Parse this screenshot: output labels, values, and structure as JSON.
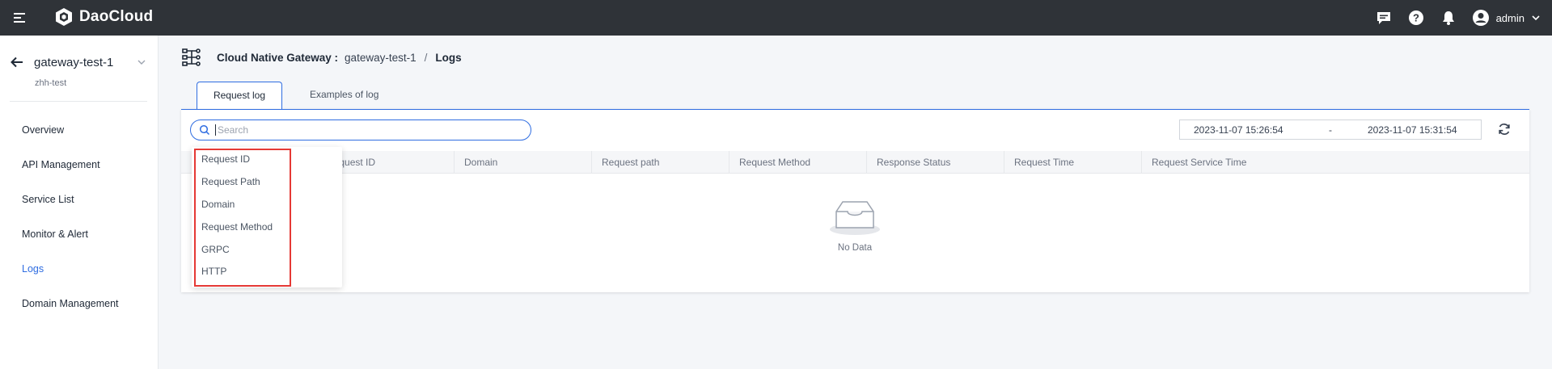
{
  "app": {
    "brand": "DaoCloud"
  },
  "user": {
    "name": "admin"
  },
  "sidebar": {
    "gateway_name": "gateway-test-1",
    "gateway_sub": "zhh-test",
    "items": [
      {
        "label": "Overview"
      },
      {
        "label": "API Management"
      },
      {
        "label": "Service List"
      },
      {
        "label": "Monitor & Alert"
      },
      {
        "label": "Logs"
      },
      {
        "label": "Domain Management"
      }
    ]
  },
  "breadcrumb": {
    "title": "Cloud Native Gateway :",
    "gateway": "gateway-test-1",
    "separator": "/",
    "current": "Logs"
  },
  "tabs": [
    {
      "label": "Request log"
    },
    {
      "label": "Examples of log"
    }
  ],
  "search": {
    "placeholder": "Search",
    "value": ""
  },
  "date_range": {
    "start": "2023-11-07 15:26:54",
    "separator": "-",
    "end": "2023-11-07 15:31:54"
  },
  "table": {
    "columns": [
      "Request ID",
      "Domain",
      "Request path",
      "Request Method",
      "Response Status",
      "Request Time",
      "Request Service Time"
    ],
    "empty_text": "No Data"
  },
  "search_fields_dropdown": [
    "Request ID",
    "Request Path",
    "Domain",
    "Request Method",
    "GRPC",
    "HTTP"
  ],
  "colors": {
    "topbar": "#2f3338",
    "accent": "#2f6de1",
    "highlight": "#e53935"
  }
}
